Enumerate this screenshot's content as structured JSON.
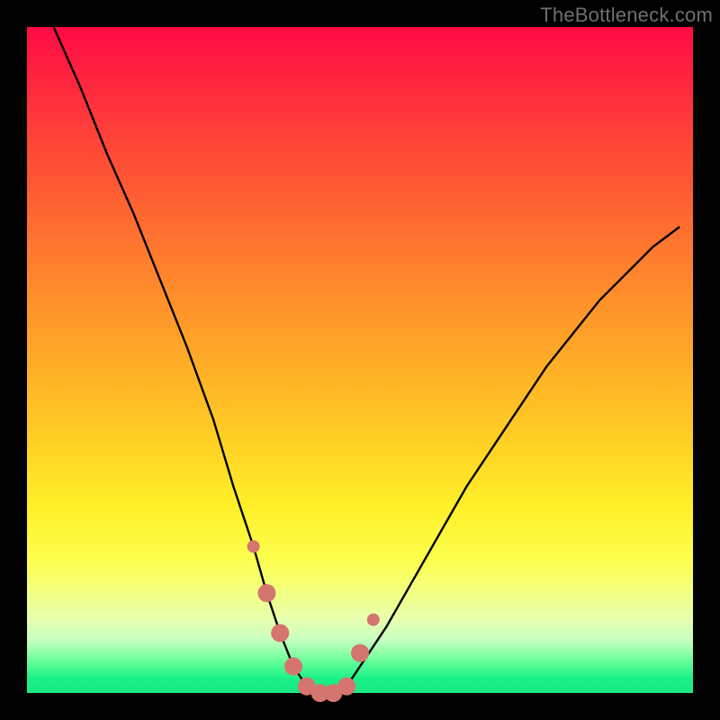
{
  "watermark": "TheBottleneck.com",
  "colors": {
    "frame_bg": "#000000",
    "curve_stroke": "#000000",
    "marker_fill": "#d5756f",
    "gradient_top": "#ff0b44",
    "gradient_bottom": "#17e884"
  },
  "chart_data": {
    "type": "line",
    "title": "",
    "xlabel": "",
    "ylabel": "",
    "x_range_fraction": [
      0,
      1
    ],
    "y_range_percent": [
      0,
      100
    ],
    "series": [
      {
        "name": "bottleneck-curve",
        "x": [
          0.04,
          0.08,
          0.12,
          0.16,
          0.2,
          0.24,
          0.28,
          0.31,
          0.34,
          0.36,
          0.38,
          0.4,
          0.42,
          0.44,
          0.46,
          0.48,
          0.5,
          0.54,
          0.58,
          0.62,
          0.66,
          0.7,
          0.74,
          0.78,
          0.82,
          0.86,
          0.9,
          0.94,
          0.98
        ],
        "y": [
          100,
          91,
          81,
          72,
          62,
          52,
          41,
          31,
          22,
          15,
          9,
          4,
          1,
          0,
          0,
          1,
          4,
          10,
          17,
          24,
          31,
          37,
          43,
          49,
          54,
          59,
          63,
          67,
          70
        ]
      }
    ],
    "markers": {
      "name": "highlight-dots",
      "x": [
        0.34,
        0.36,
        0.38,
        0.4,
        0.42,
        0.44,
        0.46,
        0.48,
        0.5,
        0.52
      ],
      "y": [
        22,
        15,
        9,
        4,
        1,
        0,
        0,
        1,
        6,
        11
      ],
      "r": [
        7,
        10,
        10,
        10,
        10,
        10,
        10,
        10,
        10,
        7
      ]
    }
  }
}
